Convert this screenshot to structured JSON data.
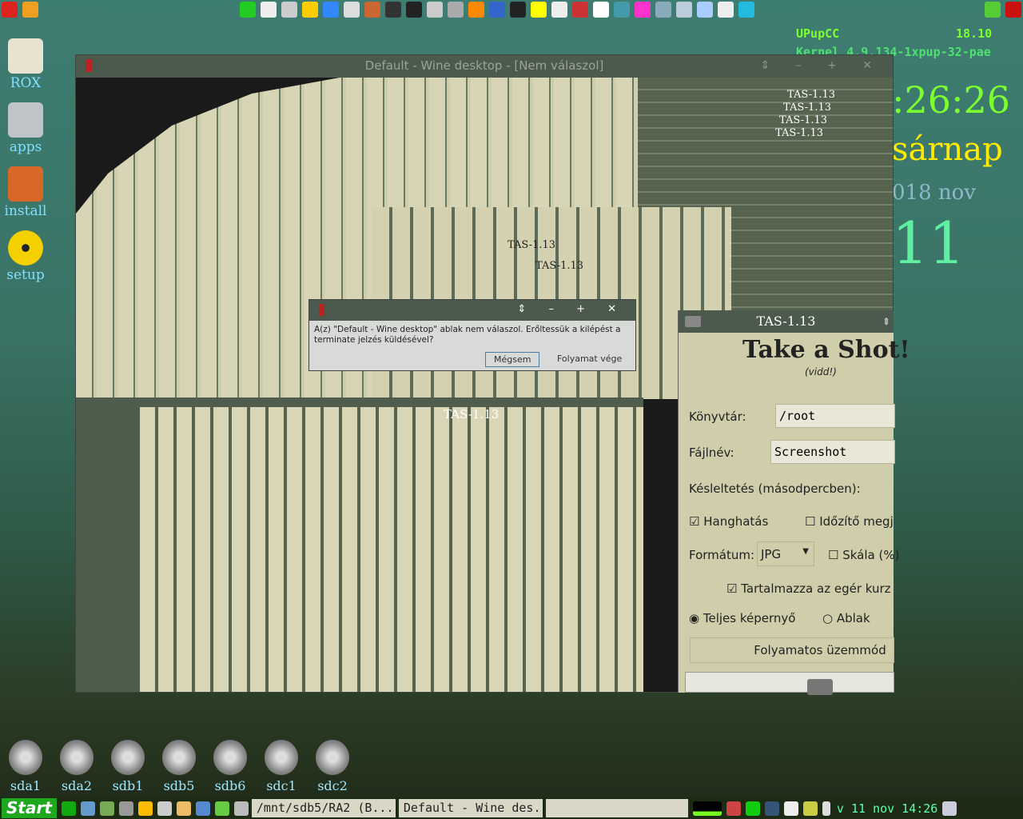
{
  "conky": {
    "distro": "UPupCC",
    "version": "18.10",
    "kernel": "Kernel 4.9.134-1xpup-32-pae",
    "time": ":26:26",
    "day": "sárnap",
    "date": "018 nov",
    "daynum": "11"
  },
  "desktop_icons": [
    {
      "label": "ROX",
      "icon": "home-icon"
    },
    {
      "label": "apps",
      "icon": "folder-icon"
    },
    {
      "label": "install",
      "icon": "package-icon"
    },
    {
      "label": "setup",
      "icon": "radiation-icon"
    }
  ],
  "drives": [
    "sda1",
    "sda2",
    "sdb1",
    "sdb5",
    "sdb6",
    "sdc1",
    "sdc2"
  ],
  "wine_window": {
    "title": "Default - Wine desktop - [Nem válaszol]",
    "controls": "⇕ – + ✕"
  },
  "trail_title": "TAS-1.13",
  "dialog": {
    "message": "A(z) \"Default - Wine desktop\" ablak nem válaszol. Erőltessük a kilépést a terminate jelzés küldésével?",
    "cancel": "Mégsem",
    "end_process": "Folyamat vége"
  },
  "tas": {
    "title": "TAS-1.13",
    "heading": "Take a Shot!",
    "subheading": "(vidd!)",
    "dir_label": "Könyvtár:",
    "dir_value": "/root",
    "file_label": "Fájlnév:",
    "file_value": "Screenshot",
    "delay_label": "Késleltetés (másodpercben):",
    "sound_label": "Hanghatás",
    "sound_checked": true,
    "timer_label": "Időzítő megj",
    "timer_checked": false,
    "format_label": "Formátum:",
    "format_value": "JPG",
    "scale_label": "Skála (%)",
    "scale_checked": false,
    "cursor_label": "Tartalmazza az egér kurz",
    "cursor_checked": true,
    "fullscreen_label": "Teljes képernyő",
    "window_label": "Ablak",
    "mode_selected": "Teljes képernyő",
    "continuous_button": "Folyamatos üzemmód"
  },
  "taskbar": {
    "start": "Start",
    "tasks": [
      "/mnt/sdb5/RA2 (B...",
      "Default - Wine des...",
      ""
    ],
    "clock": "v 11 nov 14:26"
  }
}
